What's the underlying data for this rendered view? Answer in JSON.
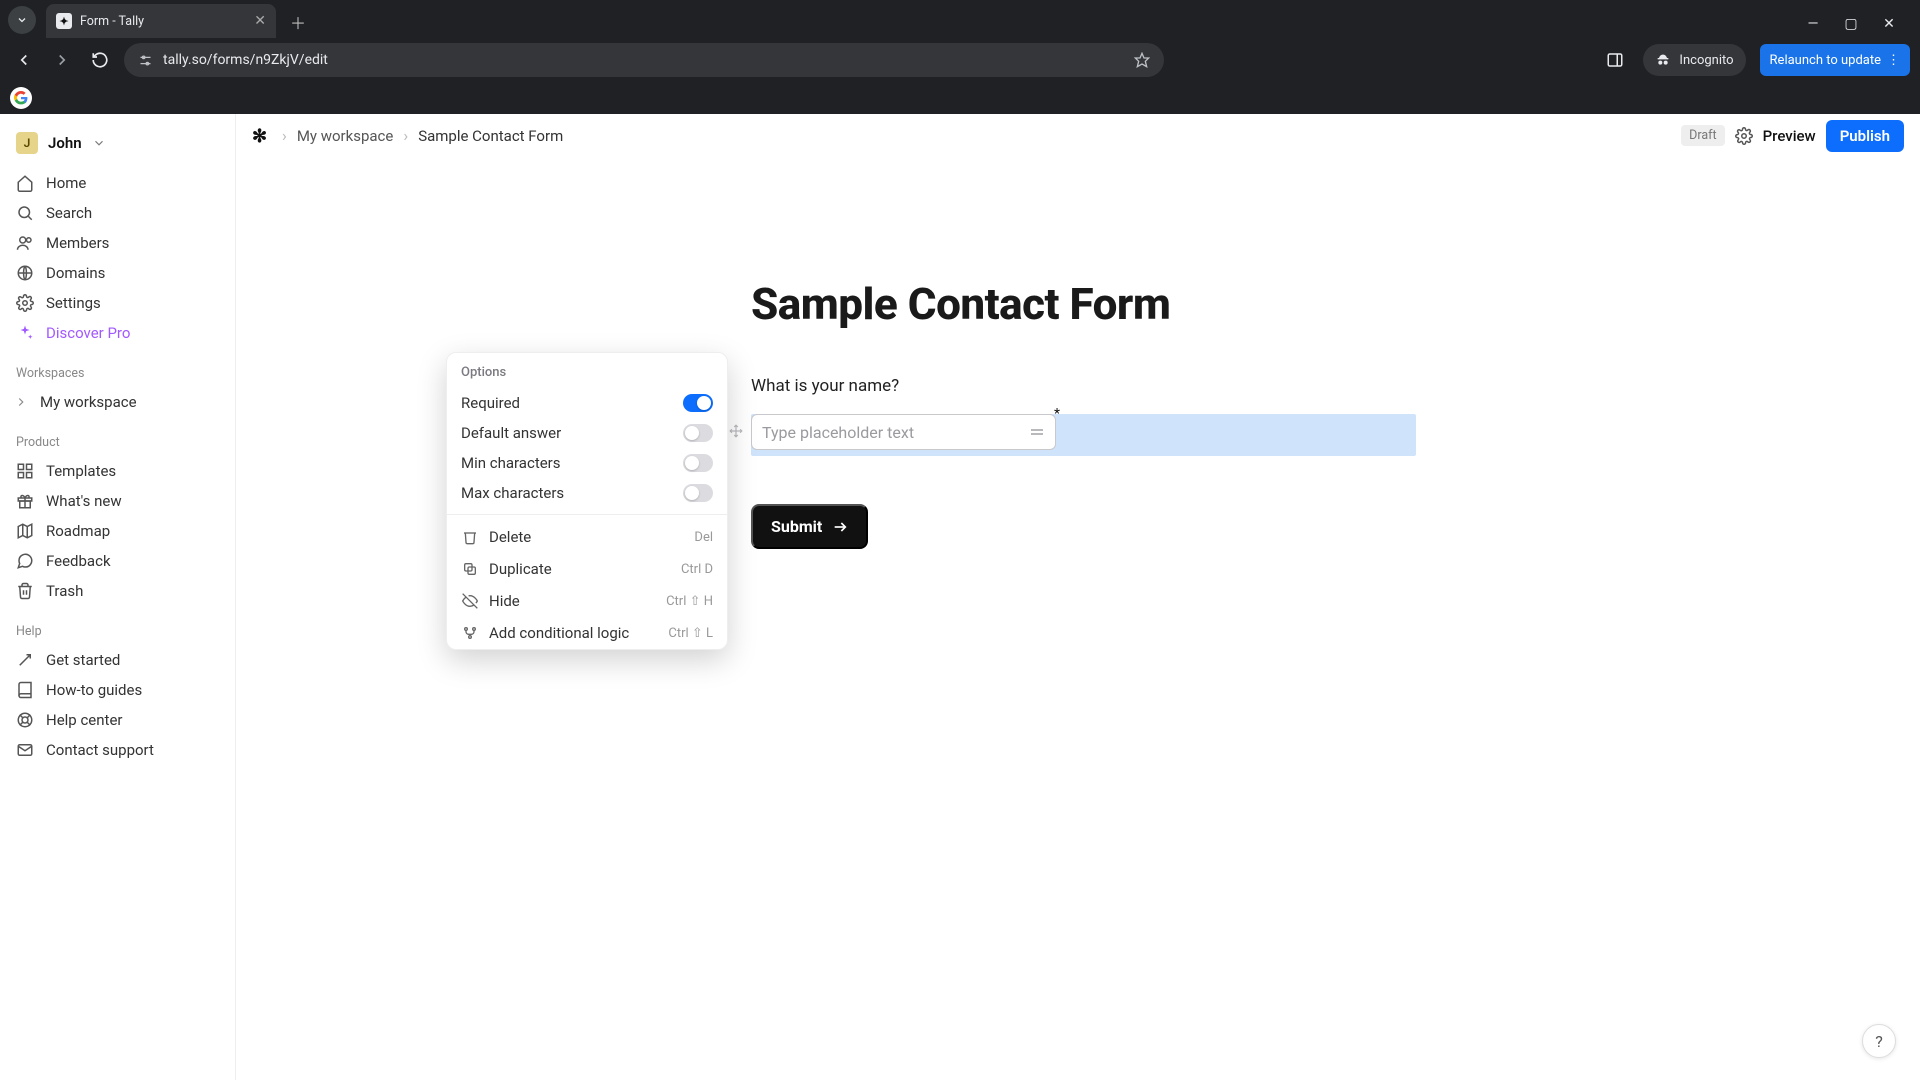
{
  "browser": {
    "tab_title": "Form - Tally",
    "url": "tally.so/forms/n9ZkjV/edit",
    "incognito_label": "Incognito",
    "relaunch_label": "Relaunch to update"
  },
  "user": {
    "initial": "J",
    "name": "John"
  },
  "sidebar": {
    "items": [
      {
        "label": "Home"
      },
      {
        "label": "Search"
      },
      {
        "label": "Members"
      },
      {
        "label": "Domains"
      },
      {
        "label": "Settings"
      },
      {
        "label": "Discover Pro"
      }
    ],
    "workspaces_label": "Workspaces",
    "workspace_name": "My workspace",
    "product_label": "Product",
    "product_items": [
      {
        "label": "Templates"
      },
      {
        "label": "What's new"
      },
      {
        "label": "Roadmap"
      },
      {
        "label": "Feedback"
      },
      {
        "label": "Trash"
      }
    ],
    "help_label": "Help",
    "help_items": [
      {
        "label": "Get started"
      },
      {
        "label": "How-to guides"
      },
      {
        "label": "Help center"
      },
      {
        "label": "Contact support"
      }
    ]
  },
  "topbar": {
    "crumb_workspace": "My workspace",
    "crumb_form": "Sample Contact Form",
    "draft_label": "Draft",
    "preview_label": "Preview",
    "publish_label": "Publish"
  },
  "form": {
    "title": "Sample Contact Form",
    "question": "What is your name?",
    "placeholder_hint": "Type placeholder text",
    "required_asterisk": "*",
    "submit_label": "Submit"
  },
  "popover": {
    "header": "Options",
    "options": [
      {
        "label": "Required",
        "on": true
      },
      {
        "label": "Default answer",
        "on": false
      },
      {
        "label": "Min characters",
        "on": false
      },
      {
        "label": "Max characters",
        "on": false
      }
    ],
    "actions": [
      {
        "label": "Delete",
        "shortcut": "Del"
      },
      {
        "label": "Duplicate",
        "shortcut": "Ctrl D"
      },
      {
        "label": "Hide",
        "shortcut": "Ctrl ⇧ H"
      },
      {
        "label": "Add conditional logic",
        "shortcut": "Ctrl ⇧ L"
      }
    ]
  },
  "help_bubble": "?"
}
